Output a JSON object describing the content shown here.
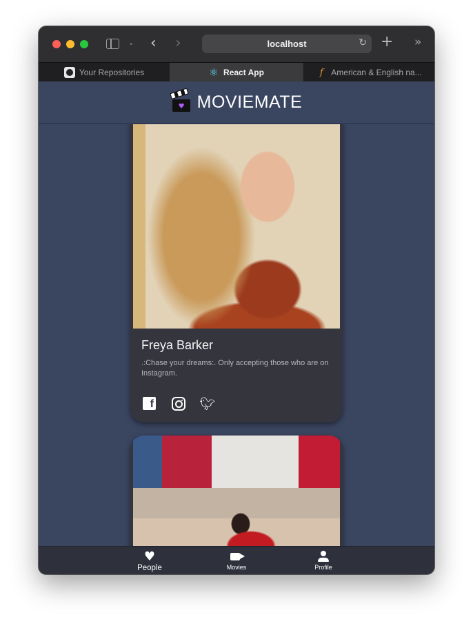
{
  "browser": {
    "url": "localhost",
    "tabs": [
      {
        "label": "Your Repositories",
        "icon": "github-icon",
        "active": false
      },
      {
        "label": "React App",
        "icon": "react-icon",
        "active": true
      },
      {
        "label": "American & English na...",
        "icon": "site-favicon-icon",
        "active": false
      }
    ]
  },
  "app": {
    "brand": "MOVIEMATE",
    "colors": {
      "background": "#3a4560",
      "card": "#34353d",
      "nav": "#2e313c",
      "accent_heart": "#b05cff"
    }
  },
  "cards": [
    {
      "name": "Freya Barker",
      "bio": ".:Chase your dreams:. Only accepting those who are on Instagram.",
      "social": [
        "facebook-icon",
        "instagram-icon",
        "twitter-icon"
      ]
    },
    {
      "name": "",
      "bio": ""
    }
  ],
  "nav": {
    "items": [
      {
        "label": "People",
        "icon": "heart-icon",
        "active": true
      },
      {
        "label": "Movies",
        "icon": "video-camera-icon",
        "active": false
      },
      {
        "label": "Profile",
        "icon": "person-icon",
        "active": false
      }
    ]
  }
}
